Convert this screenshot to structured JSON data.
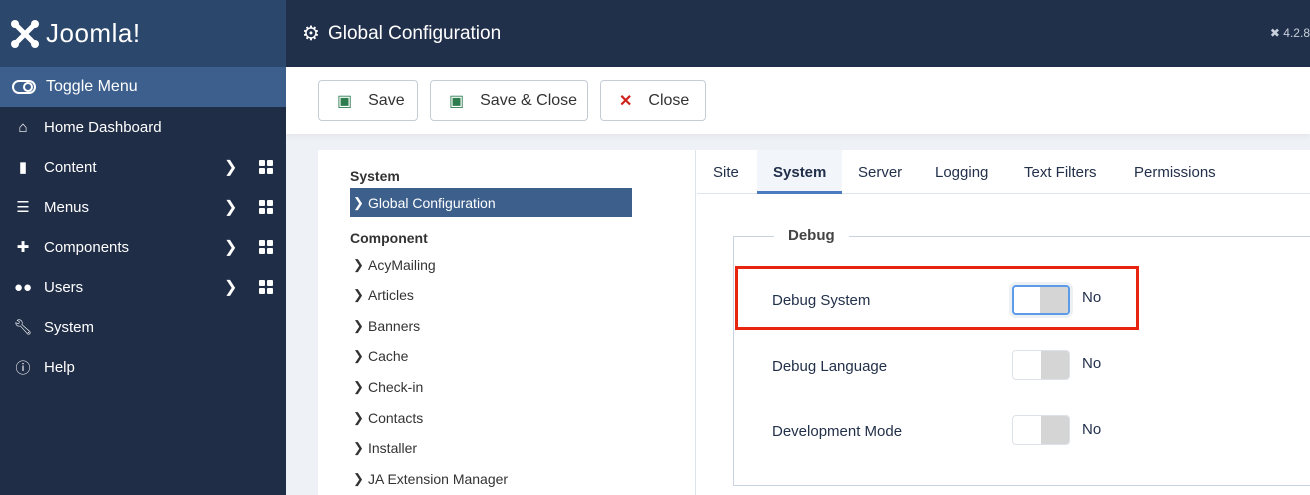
{
  "brand": {
    "logo_text": "Joomla!",
    "version": "4.2.8"
  },
  "sidebar": {
    "toggle": "Toggle Menu",
    "items": [
      {
        "label": "Home Dashboard",
        "icon": "home-icon"
      },
      {
        "label": "Content",
        "icon": "file-icon",
        "submenu": true
      },
      {
        "label": "Menus",
        "icon": "list-icon",
        "submenu": true
      },
      {
        "label": "Components",
        "icon": "puzzle-icon",
        "submenu": true
      },
      {
        "label": "Users",
        "icon": "users-icon",
        "submenu": true
      },
      {
        "label": "System",
        "icon": "wrench-icon"
      },
      {
        "label": "Help",
        "icon": "info-icon"
      }
    ]
  },
  "header": {
    "title": "Global Configuration"
  },
  "toolbar": {
    "save": "Save",
    "save_close": "Save & Close",
    "close": "Close"
  },
  "left": {
    "system_heading": "System",
    "active": "Global Configuration",
    "component_heading": "Component",
    "components": [
      "AcyMailing",
      "Articles",
      "Banners",
      "Cache",
      "Check-in",
      "Contacts",
      "Installer",
      "JA Extension Manager"
    ]
  },
  "tabs": [
    "Site",
    "System",
    "Server",
    "Logging",
    "Text Filters",
    "Permissions"
  ],
  "active_tab": "System",
  "fieldset": {
    "legend": "Debug",
    "rows": [
      {
        "label": "Debug System",
        "value": "No"
      },
      {
        "label": "Debug Language",
        "value": "No"
      },
      {
        "label": "Development Mode",
        "value": "No"
      }
    ]
  },
  "colors": {
    "highlight": "#e8240f",
    "sidebar": "#1f2d47",
    "active": "#3d5f8c"
  }
}
